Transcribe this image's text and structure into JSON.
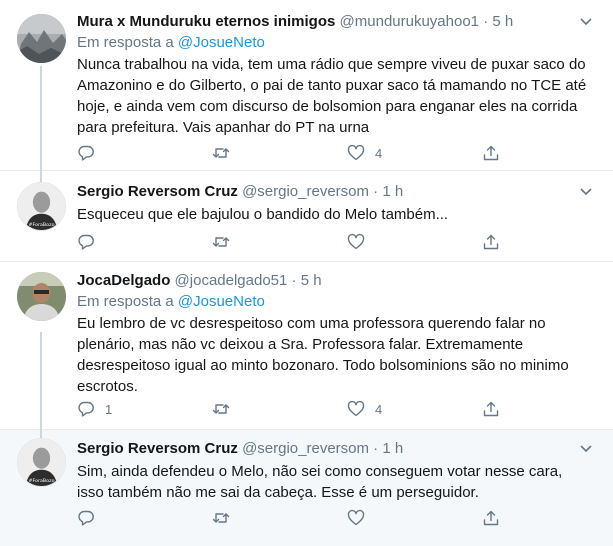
{
  "tweets": [
    {
      "name": "Mura x Munduruku eternos inimigos",
      "handle": "@mundurukuyahoo1",
      "dot": "·",
      "time": "5 h",
      "reply_prefix": "Em resposta a",
      "reply_to": "@JosueNeto",
      "text": "Nunca trabalhou na vida, tem uma rádio que sempre viveu de puxar saco do Amazonino e do Gilberto, o pai de tanto puxar saco tá mamando no TCE até hoje, e ainda vem com discurso de bolsomion para enganar eles na corrida para prefeitura. Vais apanhar do PT na urna",
      "replies": "",
      "retweets": "",
      "likes": "4"
    },
    {
      "name": "Sergio Reversom Cruz",
      "handle": "@sergio_reversom",
      "dot": "·",
      "time": "1 h",
      "avatar_badge": "#ForaBozo",
      "text": "Esqueceu que ele bajulou o bandido do Melo também...",
      "replies": "",
      "retweets": "",
      "likes": ""
    },
    {
      "name": "JocaDelgado",
      "handle": "@jocadelgado51",
      "dot": "·",
      "time": "5 h",
      "reply_prefix": "Em resposta a",
      "reply_to": "@JosueNeto",
      "text": "Eu lembro de vc desrespeitoso com uma professora querendo falar no plenário, mas não vc deixou a Sra. Professora falar. Extremamente desrespeitoso igual ao minto bozonaro. Todo bolsominions são no minimo escrotos.",
      "replies": "1",
      "retweets": "",
      "likes": "4"
    },
    {
      "name": "Sergio Reversom Cruz",
      "handle": "@sergio_reversom",
      "dot": "·",
      "time": "1 h",
      "avatar_badge": "#ForaBozo",
      "text": "Sim, ainda defendeu o Melo, não sei como conseguem votar nesse cara, isso também não me sai da cabeça. Esse é um perseguidor.",
      "replies": "",
      "retweets": "",
      "likes": ""
    }
  ],
  "colors": {
    "text": "#14171a",
    "secondary": "#657786",
    "link": "#1b95e0",
    "divider": "#e6ecf0",
    "highlight_bg": "#f5f8fa",
    "thread_line": "#ccd6dd"
  },
  "icons": {
    "reply": "reply-icon",
    "retweet": "retweet-icon",
    "like": "heart-icon",
    "share": "share-icon",
    "more": "chevron-down-icon"
  }
}
